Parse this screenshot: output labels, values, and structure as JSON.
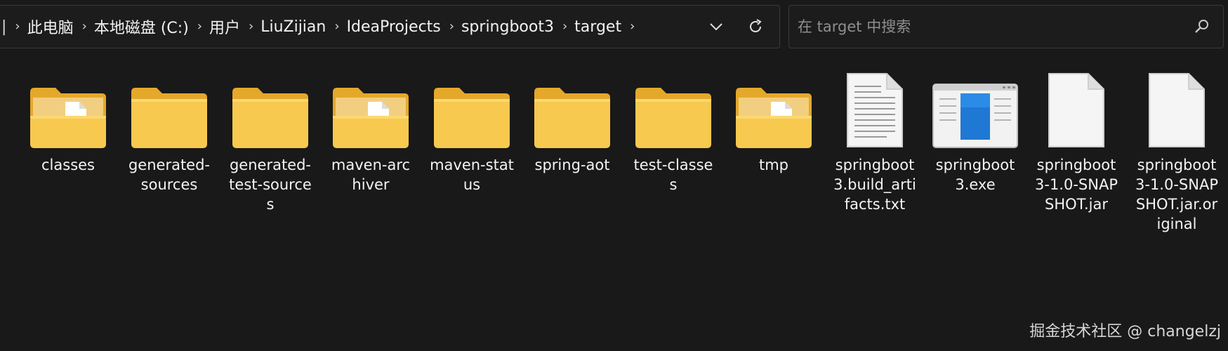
{
  "address": {
    "crumbs": [
      "此电脑",
      "本地磁盘 (C:)",
      "用户",
      "LiuZijian",
      "IdeaProjects",
      "springboot3",
      "target"
    ]
  },
  "search": {
    "placeholder": "在 target 中搜索"
  },
  "items": [
    {
      "label": "classes",
      "icon": "folder-with-file-icon"
    },
    {
      "label": "generated-sources",
      "icon": "folder-icon"
    },
    {
      "label": "generated-test-sources",
      "icon": "folder-icon"
    },
    {
      "label": "maven-archiver",
      "icon": "folder-with-file-icon"
    },
    {
      "label": "maven-status",
      "icon": "folder-icon"
    },
    {
      "label": "spring-aot",
      "icon": "folder-icon"
    },
    {
      "label": "test-classes",
      "icon": "folder-icon"
    },
    {
      "label": "tmp",
      "icon": "folder-with-file-icon"
    },
    {
      "label": "springboot3.build_artifacts.txt",
      "icon": "text-file-icon"
    },
    {
      "label": "springboot3.exe",
      "icon": "exe-file-icon"
    },
    {
      "label": "springboot3-1.0-SNAPSHOT.jar",
      "icon": "blank-file-icon"
    },
    {
      "label": "springboot3-1.0-SNAPSHOT.jar.original",
      "icon": "blank-file-icon"
    }
  ],
  "watermark": "掘金技术社区 @ changelzj",
  "colors": {
    "background": "#191919",
    "folder": "#f7c94f",
    "exe_accent": "#1e78d4"
  }
}
